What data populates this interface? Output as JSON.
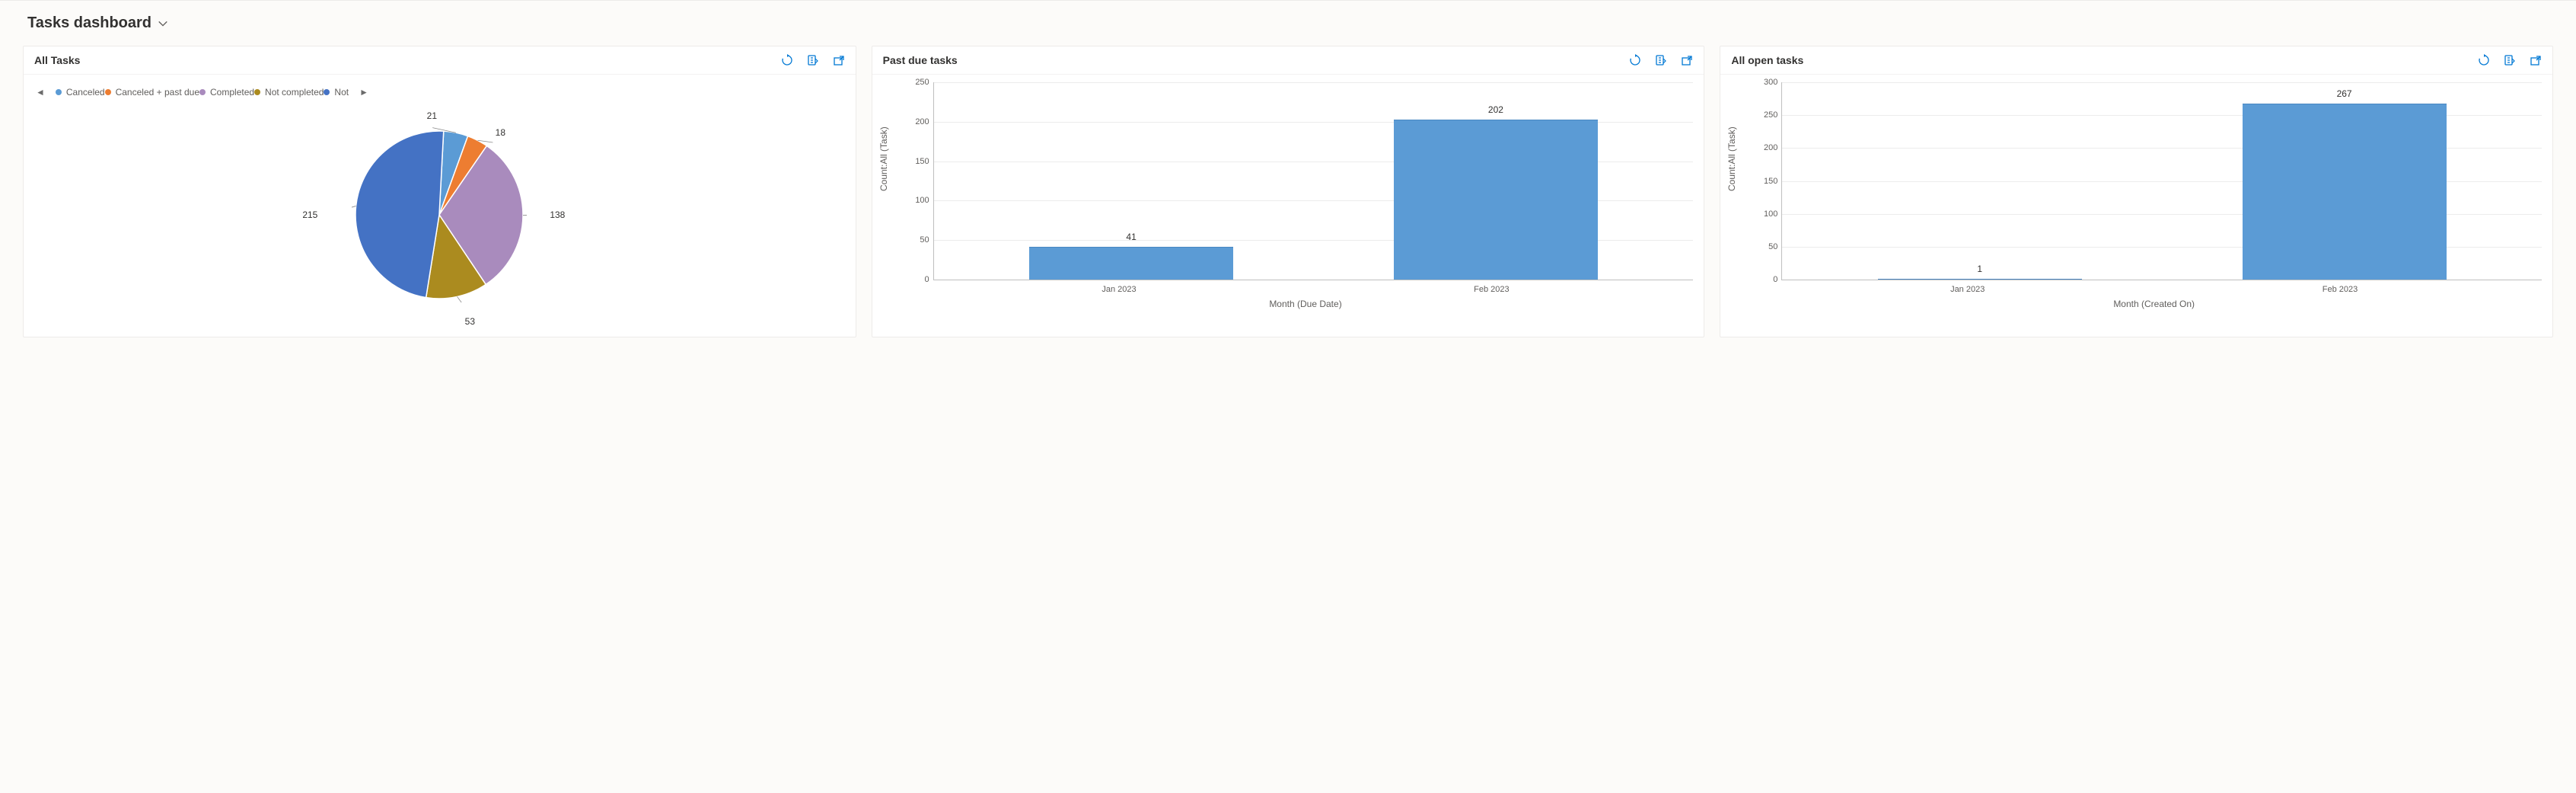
{
  "header": {
    "title": "Tasks dashboard"
  },
  "cards": {
    "all_tasks": {
      "title": "All Tasks",
      "legend": [
        {
          "label": "Canceled",
          "color": "#5b9bd5"
        },
        {
          "label": "Canceled + past due",
          "color": "#ed7d31"
        },
        {
          "label": "Completed",
          "color": "#a98bbd"
        },
        {
          "label": "Not completed",
          "color": "#ab8b1f"
        },
        {
          "label": "Not",
          "color": "#4472c4"
        }
      ]
    },
    "past_due": {
      "title": "Past due tasks",
      "ylabel": "Count:All (Task)",
      "xlabel": "Month (Due Date)"
    },
    "open_tasks": {
      "title": "All open tasks",
      "ylabel": "Count:All (Task)",
      "xlabel": "Month (Created On)"
    }
  },
  "chart_data": [
    {
      "type": "pie",
      "title": "All Tasks",
      "series": [
        {
          "name": "Canceled",
          "value": 21,
          "color": "#5b9bd5"
        },
        {
          "name": "Canceled + past due",
          "value": 18,
          "color": "#ed7d31"
        },
        {
          "name": "Completed",
          "value": 138,
          "color": "#a98bbd"
        },
        {
          "name": "Not completed",
          "value": 53,
          "color": "#ab8b1f"
        },
        {
          "name": "Not completed + past due",
          "value": 215,
          "color": "#4472c4"
        }
      ]
    },
    {
      "type": "bar",
      "title": "Past due tasks",
      "xlabel": "Month (Due Date)",
      "ylabel": "Count:All (Task)",
      "ylim": [
        0,
        250
      ],
      "ystep": 50,
      "categories": [
        "Jan 2023",
        "Feb 2023"
      ],
      "values": [
        41,
        202
      ],
      "color": "#5b9bd5"
    },
    {
      "type": "bar",
      "title": "All open tasks",
      "xlabel": "Month (Created On)",
      "ylabel": "Count:All (Task)",
      "ylim": [
        0,
        300
      ],
      "ystep": 50,
      "categories": [
        "Jan 2023",
        "Feb 2023"
      ],
      "values": [
        1,
        267
      ],
      "color": "#5b9bd5"
    }
  ]
}
